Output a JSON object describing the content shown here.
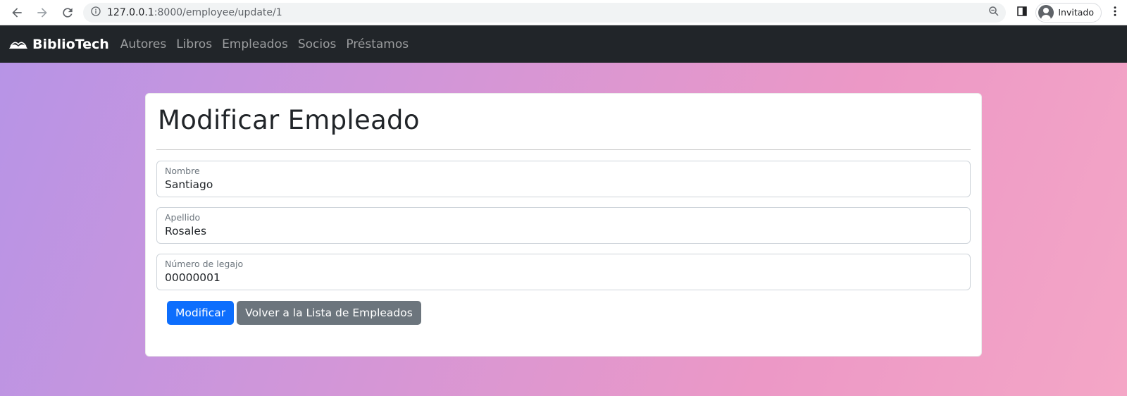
{
  "browser": {
    "url_host": "127.0.0.1",
    "url_path": ":8000/employee/update/1",
    "profile_label": "Invitado"
  },
  "navbar": {
    "brand": "BiblioTech",
    "links": [
      "Autores",
      "Libros",
      "Empleados",
      "Socios",
      "Préstamos"
    ]
  },
  "form": {
    "title": "Modificar Empleado",
    "fields": [
      {
        "label": "Nombre",
        "value": "Santiago"
      },
      {
        "label": "Apellido",
        "value": "Rosales"
      },
      {
        "label": "Número de legajo",
        "value": "00000001"
      }
    ],
    "submit_label": "Modificar",
    "back_label": "Volver a la Lista de Empleados"
  },
  "colors": {
    "navbar_bg": "#212529",
    "primary": "#0d6efd",
    "secondary": "#6c757d",
    "gradient_start": "#b794e6",
    "gradient_end": "#f4a6c6"
  }
}
